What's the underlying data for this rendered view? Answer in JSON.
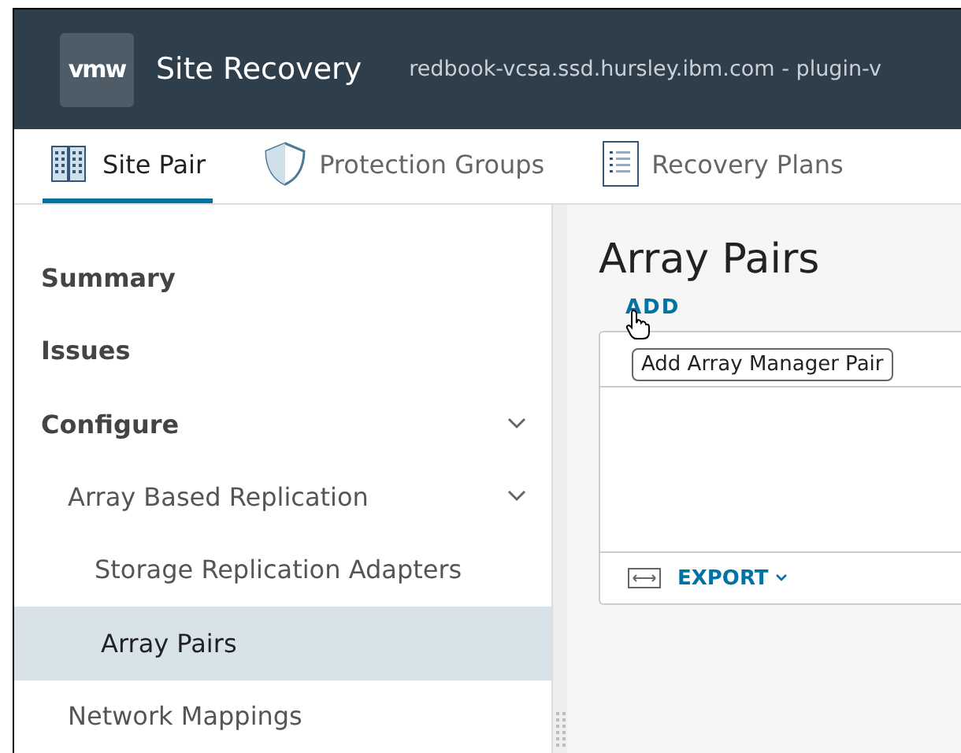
{
  "header": {
    "logo": "vmw",
    "title": "Site Recovery",
    "context": "redbook-vcsa.ssd.hursley.ibm.com - plugin-v"
  },
  "tabs": [
    {
      "label": "Site Pair",
      "selected": true
    },
    {
      "label": "Protection Groups",
      "selected": false
    },
    {
      "label": "Recovery Plans",
      "selected": false
    }
  ],
  "sidebar": {
    "items": [
      {
        "label": "Summary",
        "selected": false
      },
      {
        "label": "Issues",
        "selected": false
      },
      {
        "label": "Configure",
        "selected": false,
        "expanded": true,
        "children": [
          {
            "label": "Array Based Replication",
            "selected": false,
            "expanded": true,
            "children": [
              {
                "label": "Storage Replication Adapters",
                "selected": false
              },
              {
                "label": "Array Pairs",
                "selected": true
              }
            ]
          },
          {
            "label": "Network Mappings",
            "selected": false
          }
        ]
      }
    ]
  },
  "main": {
    "title": "Array Pairs",
    "add_button": "ADD",
    "tooltip": "Add Array Manager Pair",
    "export_button": "EXPORT"
  }
}
